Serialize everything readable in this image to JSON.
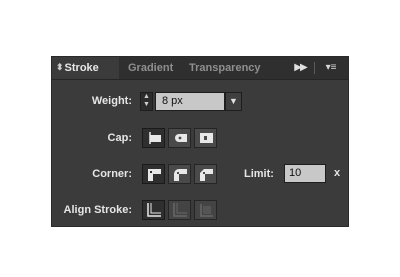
{
  "tabs": [
    {
      "label": "Stroke",
      "active": true
    },
    {
      "label": "Gradient",
      "active": false
    },
    {
      "label": "Transparency",
      "active": false
    }
  ],
  "icons": {
    "tab_sort": "updown-arrows-icon",
    "expand": "double-chevron-right-icon",
    "panel_menu": "panel-menu-icon"
  },
  "glyphs": {
    "tab_sort": "⬍",
    "expand": "▶▶",
    "panel_menu": "▾≡",
    "stepper_up": "▲",
    "stepper_down": "▼",
    "dropdown": "▼"
  },
  "weight": {
    "label": "Weight:",
    "value": "8 px"
  },
  "cap": {
    "label": "Cap:",
    "options": [
      "butt-cap-icon",
      "round-cap-icon",
      "projecting-cap-icon"
    ],
    "selected": 0
  },
  "corner": {
    "label": "Corner:",
    "options": [
      "miter-join-icon",
      "round-join-icon",
      "bevel-join-icon"
    ],
    "selected": 0,
    "limit_label": "Limit:",
    "limit_value": "10",
    "limit_suffix": "x"
  },
  "align_stroke": {
    "label": "Align Stroke:",
    "options": [
      "align-center-icon",
      "align-inside-icon",
      "align-outside-icon"
    ],
    "selected": 0
  },
  "colors": {
    "panel_bg": "#3b3b3b",
    "tab_bar_bg": "#2f2f2f",
    "input_bg": "#c8c8c8",
    "label_text": "#e6e6e6"
  }
}
